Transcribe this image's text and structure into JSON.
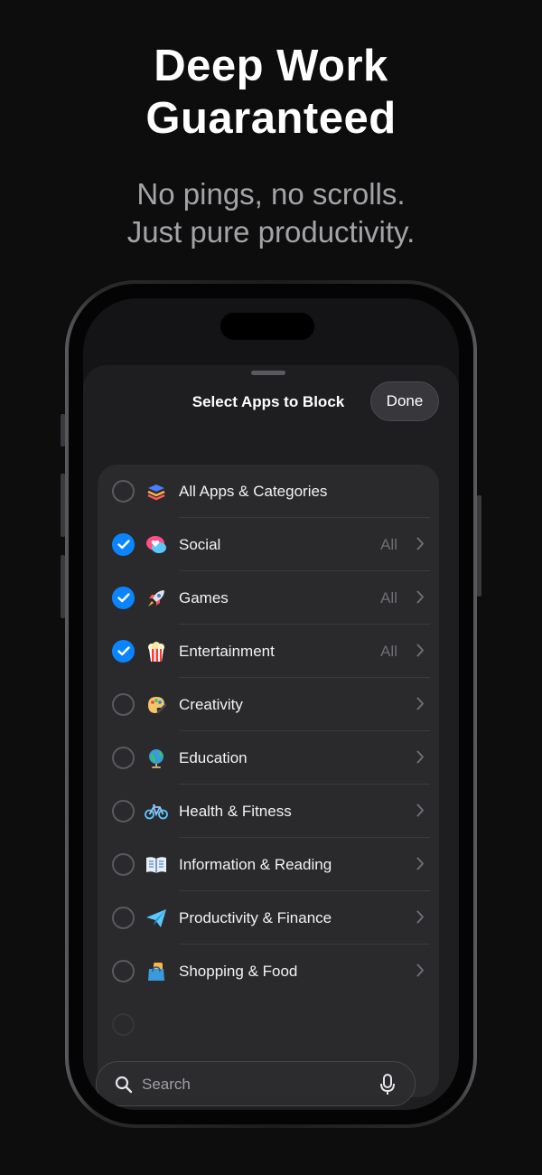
{
  "promo": {
    "headline": [
      "Deep Work",
      "Guaranteed"
    ],
    "subline": [
      "No pings, no scrolls.",
      "Just pure productivity."
    ]
  },
  "sheet": {
    "title": "Select Apps to Block",
    "done_label": "Done"
  },
  "categories": [
    {
      "label": "All Apps & Categories",
      "checked": false,
      "all": "",
      "chevron": false,
      "icon": "stack-icon"
    },
    {
      "label": "Social",
      "checked": true,
      "all": "All",
      "chevron": true,
      "icon": "speech-heart-icon"
    },
    {
      "label": "Games",
      "checked": true,
      "all": "All",
      "chevron": true,
      "icon": "rocket-icon"
    },
    {
      "label": "Entertainment",
      "checked": true,
      "all": "All",
      "chevron": true,
      "icon": "popcorn-icon"
    },
    {
      "label": "Creativity",
      "checked": false,
      "all": "",
      "chevron": true,
      "icon": "palette-icon"
    },
    {
      "label": "Education",
      "checked": false,
      "all": "",
      "chevron": true,
      "icon": "globe-icon"
    },
    {
      "label": "Health & Fitness",
      "checked": false,
      "all": "",
      "chevron": true,
      "icon": "bicycle-icon"
    },
    {
      "label": "Information & Reading",
      "checked": false,
      "all": "",
      "chevron": true,
      "icon": "book-icon"
    },
    {
      "label": "Productivity & Finance",
      "checked": false,
      "all": "",
      "chevron": true,
      "icon": "paper-plane-icon"
    },
    {
      "label": "Shopping & Food",
      "checked": false,
      "all": "",
      "chevron": true,
      "icon": "shopping-bag-icon"
    }
  ],
  "search": {
    "placeholder": "Search"
  },
  "colors": {
    "accent": "#0a84ff",
    "background": "#0d0d0e",
    "sheet": "#1e1e21",
    "list": "#2a2a2d"
  }
}
